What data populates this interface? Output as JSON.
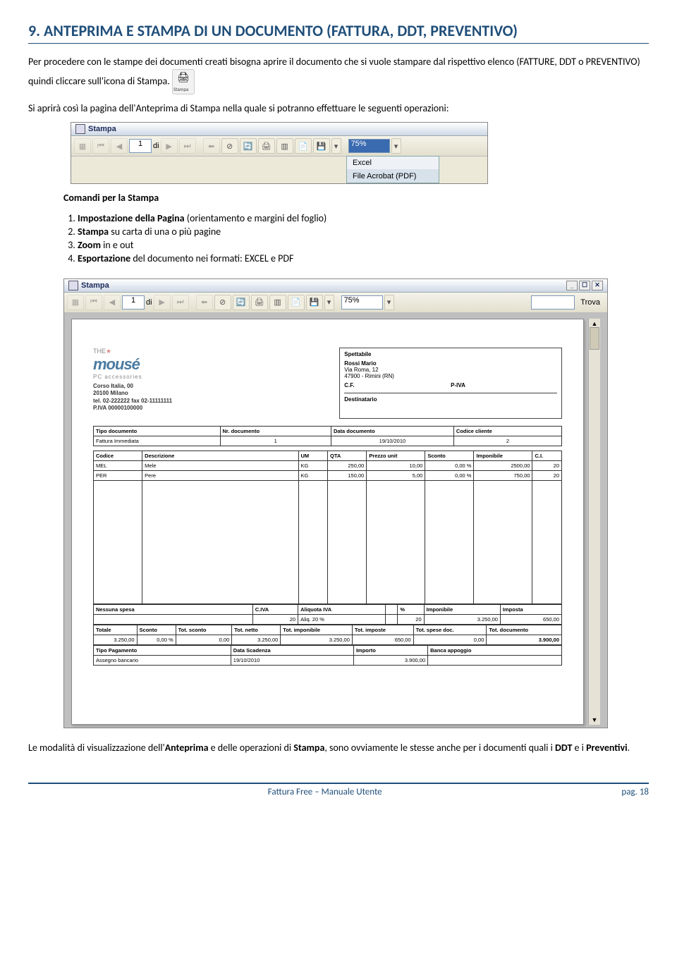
{
  "section": {
    "title": "9. ANTEPRIMA E STAMPA DI UN DOCUMENTO (FATTURA, DDT, PREVENTIVO)",
    "p1a": "Per procedere con le stampe dei documenti creati bisogna aprire il documento che si vuole stampare dal rispettivo elenco (FATTURE, DDT o PREVENTIVO) quindi cliccare sull'icona di Stampa.",
    "p2": "Si aprirà così la pagina dell'Anteprima di Stampa nella quale si potranno effettuare le seguenti operazioni:",
    "cmdtitle": "Comandi per la Stampa",
    "items": [
      {
        "b": "Impostazione della Pagina",
        "t": " (orientamento e margini del foglio)"
      },
      {
        "b": "Stampa",
        "t": " su carta di una o più pagine"
      },
      {
        "b": "Zoom",
        "t": " in e out"
      },
      {
        "b": "Esportazione",
        "t": " del documento nei formati: EXCEL e PDF"
      }
    ],
    "p3a": "Le modalità di visualizzazione dell'",
    "p3b": "Anteprima",
    "p3c": " e delle operazioni di ",
    "p3d": "Stampa",
    "p3e": ", sono ovviamente le stesse anche per i documenti quali i ",
    "p3f": "DDT",
    "p3g": " e i ",
    "p3h": "Preventivi",
    "p3i": "."
  },
  "tb": {
    "title": "Stampa",
    "page": "1",
    "of": "di",
    "zoom": "75%",
    "exportOptions": [
      "Excel",
      "File Acrobat (PDF)"
    ],
    "trova": "Trova"
  },
  "preview": {
    "company": {
      "logo": "mousé",
      "tag": "PC accessories",
      "addr1": "Corso Italia, 00",
      "addr2": "20100 Milano",
      "tel": "tel. 02-222222 fax 02-11111111",
      "piva": "P.IVA 00000100000"
    },
    "dest": {
      "spettabile_lab": "Spettabile",
      "name": "Rossi Mario",
      "via": "Via Roma, 12",
      "city": "47900 - Rimini (RN)",
      "cf_lab": "C.F.",
      "piva_lab": "P-IVA",
      "destinatario_lab": "Destinatario"
    },
    "docinfo": {
      "h1": "Tipo documento",
      "v1": "Fattura Immediata",
      "h2": "Nr. documento",
      "v2": "1",
      "h3": "Data documento",
      "v3": "19/10/2010",
      "h4": "Codice cliente",
      "v4": "2"
    },
    "cols": [
      "Codice",
      "Descrizione",
      "UM",
      "QTA",
      "Prezzo unit",
      "Sconto",
      "Imponibile",
      "C.I."
    ],
    "rows": [
      {
        "cod": "MEL",
        "desc": "Mele",
        "um": "KG",
        "qta": "250,00",
        "pu": "10,00",
        "sc": "0,00 %",
        "imp": "2500,00",
        "ci": "20"
      },
      {
        "cod": "PER",
        "desc": "Pere",
        "um": "KG",
        "qta": "150,00",
        "pu": "5,00",
        "sc": "0,00 %",
        "imp": "750,00",
        "ci": "20"
      }
    ],
    "spesa": {
      "lab": "Nessuna spesa",
      "civa": "C.IVA",
      "civa_v": "20",
      "aliq": "Aliquota IVA",
      "aliq_v": "Aliq. 20 %",
      "pct": "%",
      "pct_v": "20",
      "impon": "Imponibile",
      "impon_v": "3.250,00",
      "imposta": "Imposta",
      "imposta_v": "650,00"
    },
    "totali": {
      "h": [
        "Totale",
        "Sconto",
        "Tot. sconto",
        "Tot. netto",
        "Tot. imponibile",
        "Tot. imposte",
        "Tot. spese doc.",
        "Tot. documento"
      ],
      "v": [
        "3.250,00",
        "0,00 %",
        "0,00",
        "3.250,00",
        "3.250,00",
        "650,00",
        "0,00",
        "3.900,00"
      ]
    },
    "pag": {
      "h": [
        "Tipo Pagamento",
        "Data Scadenza",
        "Importo",
        "Banca appoggio"
      ],
      "v": [
        "Assegno bancario",
        "19/10/2010",
        "3.900,00",
        ""
      ]
    }
  },
  "footer": {
    "center": "Fattura Free – Manuale Utente",
    "right": "pag. 18"
  }
}
